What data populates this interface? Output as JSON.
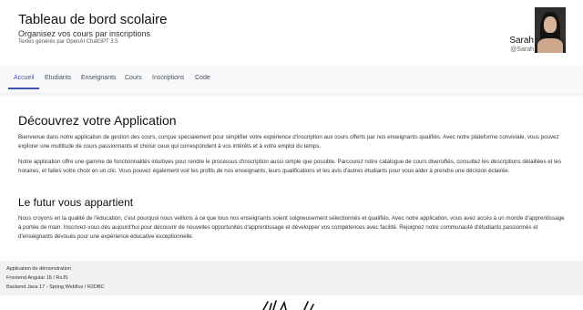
{
  "header": {
    "title": "Tableau de bord scolaire",
    "subtitle": "Organisez vos cours par inscriptions",
    "credit": "Textes générés par OpenAI ChatGPT 3.5",
    "user": {
      "name": "Sarah",
      "handle": "@Sarah"
    }
  },
  "nav": {
    "items": [
      {
        "label": "Accueil",
        "active": true
      },
      {
        "label": "Etudiants"
      },
      {
        "label": "Enseignants"
      },
      {
        "label": "Cours"
      },
      {
        "label": "Inscriptions"
      },
      {
        "label": "Code"
      }
    ],
    "accent_color": "#3f51b5"
  },
  "main": {
    "heading1": "Découvrez votre Application",
    "para1": "Bienvenue dans notre application de gestion des cours, conçue spécialement pour simplifier votre expérience d'inscription aux cours offerts par nos enseignants qualifiés. Avec notre plateforme conviviale, vous pouvez explorer une multitude de cours passionnants et choisir ceux qui correspondent à vos intérêts et à votre emploi du temps.",
    "para2": "Notre application offre une gamme de fonctionnalités intuitives pour rendre le processus d'inscription aussi simple que possible. Parcourez notre catalogue de cours diversifiés, consultez les descriptions détaillées et les horaires, et faites votre choix en un clic. Vous pouvez également voir les profils de nos enseignants, leurs qualifications et les avis d'autres étudiants pour vous aider à prendre une décision éclairée.",
    "heading2": "Le futur vous appartient",
    "para3": "Nous croyons en la qualité de l'éducation, c'est pourquoi nous veillons à ce que tous nos enseignants soient soigneusement sélectionnés et qualifiés. Avec notre application, vous avez accès à un monde d'apprentissage à portée de main. Inscrivez-vous dès aujourd'hui pour découvrir de nouvelles opportunités d'apprentissage et développer vos compétences avec facilité. Rejoignez notre communauté d'étudiants passionnés et d'enseignants dévoués pour une expérience éducative exceptionnelle."
  },
  "footer": {
    "line1": "Application de démonstration",
    "line2": "Frontend Angular 16 / RxJS",
    "line3": "Backend Java 17 - Spring Webflux / R2DBC"
  }
}
